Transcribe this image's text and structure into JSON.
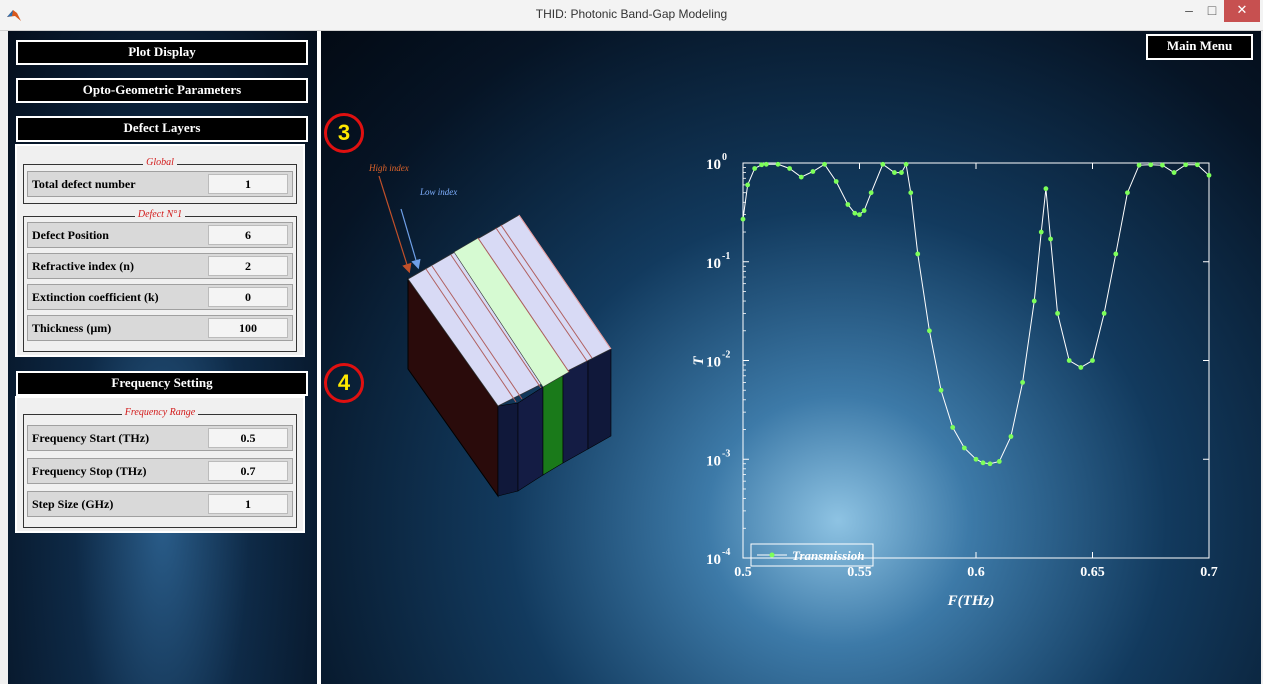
{
  "window": {
    "title": "THID: Photonic Band-Gap Modeling",
    "minimize": "–",
    "maximize": "□",
    "close": "✕"
  },
  "left_panel": {
    "plot_display": "Plot Display",
    "opto_geometric": "Opto-Geometric Parameters",
    "defect_layers": "Defect Layers",
    "global_group": {
      "title": "Global",
      "rows": [
        {
          "label": "Total defect number",
          "value": "1"
        }
      ]
    },
    "defect_group": {
      "title": "Defect N°1",
      "rows": [
        {
          "label": "Defect Position",
          "value": "6"
        },
        {
          "label": "Refractive index  (n)",
          "value": "2"
        },
        {
          "label": "Extinction coefficient (k)",
          "value": "0"
        },
        {
          "label": "Thickness (µm)",
          "value": "100"
        }
      ]
    },
    "frequency_setting": "Frequency Setting",
    "frequency_group": {
      "title": "Frequency Range",
      "rows": [
        {
          "label": "Frequency Start  (THz)",
          "value": "0.5"
        },
        {
          "label": "Frequency Stop (THz)",
          "value": "0.7"
        },
        {
          "label": "Step Size (GHz)",
          "value": "1"
        }
      ]
    }
  },
  "main_menu": "Main Menu",
  "badges": {
    "three": "3",
    "four": "4"
  },
  "structure": {
    "high_index": "High index",
    "low_index": "Low index"
  },
  "colors": {
    "curve": "#7dff5a",
    "badge_ring": "#e01010",
    "badge_text": "#ffe900",
    "defect_layer": "#1a7a1a",
    "high_index_arrow": "#c0502a",
    "low_index_arrow": "#6fa0e8"
  },
  "chart_data": {
    "type": "line",
    "xlabel": "F(THz)",
    "ylabel": "T",
    "xlim": [
      0.5,
      0.7
    ],
    "ylim": [
      0.0001,
      1
    ],
    "yscale": "log",
    "x_ticks": [
      "0.5",
      "0.55",
      "0.6",
      "0.65",
      "0.7"
    ],
    "y_ticks": [
      {
        "base": "10",
        "exp": "0"
      },
      {
        "base": "10",
        "exp": "-1"
      },
      {
        "base": "10",
        "exp": "-2"
      },
      {
        "base": "10",
        "exp": "-3"
      },
      {
        "base": "10",
        "exp": "-4"
      }
    ],
    "legend": "bottom-left",
    "series": [
      {
        "name": "Transmission",
        "x": [
          0.5,
          0.502,
          0.505,
          0.508,
          0.51,
          0.515,
          0.52,
          0.525,
          0.53,
          0.535,
          0.54,
          0.545,
          0.548,
          0.55,
          0.552,
          0.555,
          0.56,
          0.565,
          0.568,
          0.57,
          0.572,
          0.575,
          0.58,
          0.585,
          0.59,
          0.595,
          0.6,
          0.603,
          0.606,
          0.61,
          0.615,
          0.62,
          0.625,
          0.628,
          0.63,
          0.632,
          0.635,
          0.64,
          0.645,
          0.65,
          0.655,
          0.66,
          0.665,
          0.67,
          0.675,
          0.68,
          0.685,
          0.69,
          0.695,
          0.7
        ],
        "y": [
          0.27,
          0.6,
          0.88,
          0.96,
          0.97,
          0.97,
          0.88,
          0.72,
          0.82,
          0.97,
          0.65,
          0.38,
          0.31,
          0.3,
          0.33,
          0.5,
          0.97,
          0.8,
          0.8,
          0.97,
          0.5,
          0.12,
          0.02,
          0.005,
          0.0021,
          0.0013,
          0.001,
          0.00092,
          0.0009,
          0.00095,
          0.0017,
          0.006,
          0.04,
          0.2,
          0.55,
          0.17,
          0.03,
          0.01,
          0.0085,
          0.01,
          0.03,
          0.12,
          0.5,
          0.95,
          0.96,
          0.95,
          0.8,
          0.96,
          0.96,
          0.75
        ]
      }
    ]
  }
}
